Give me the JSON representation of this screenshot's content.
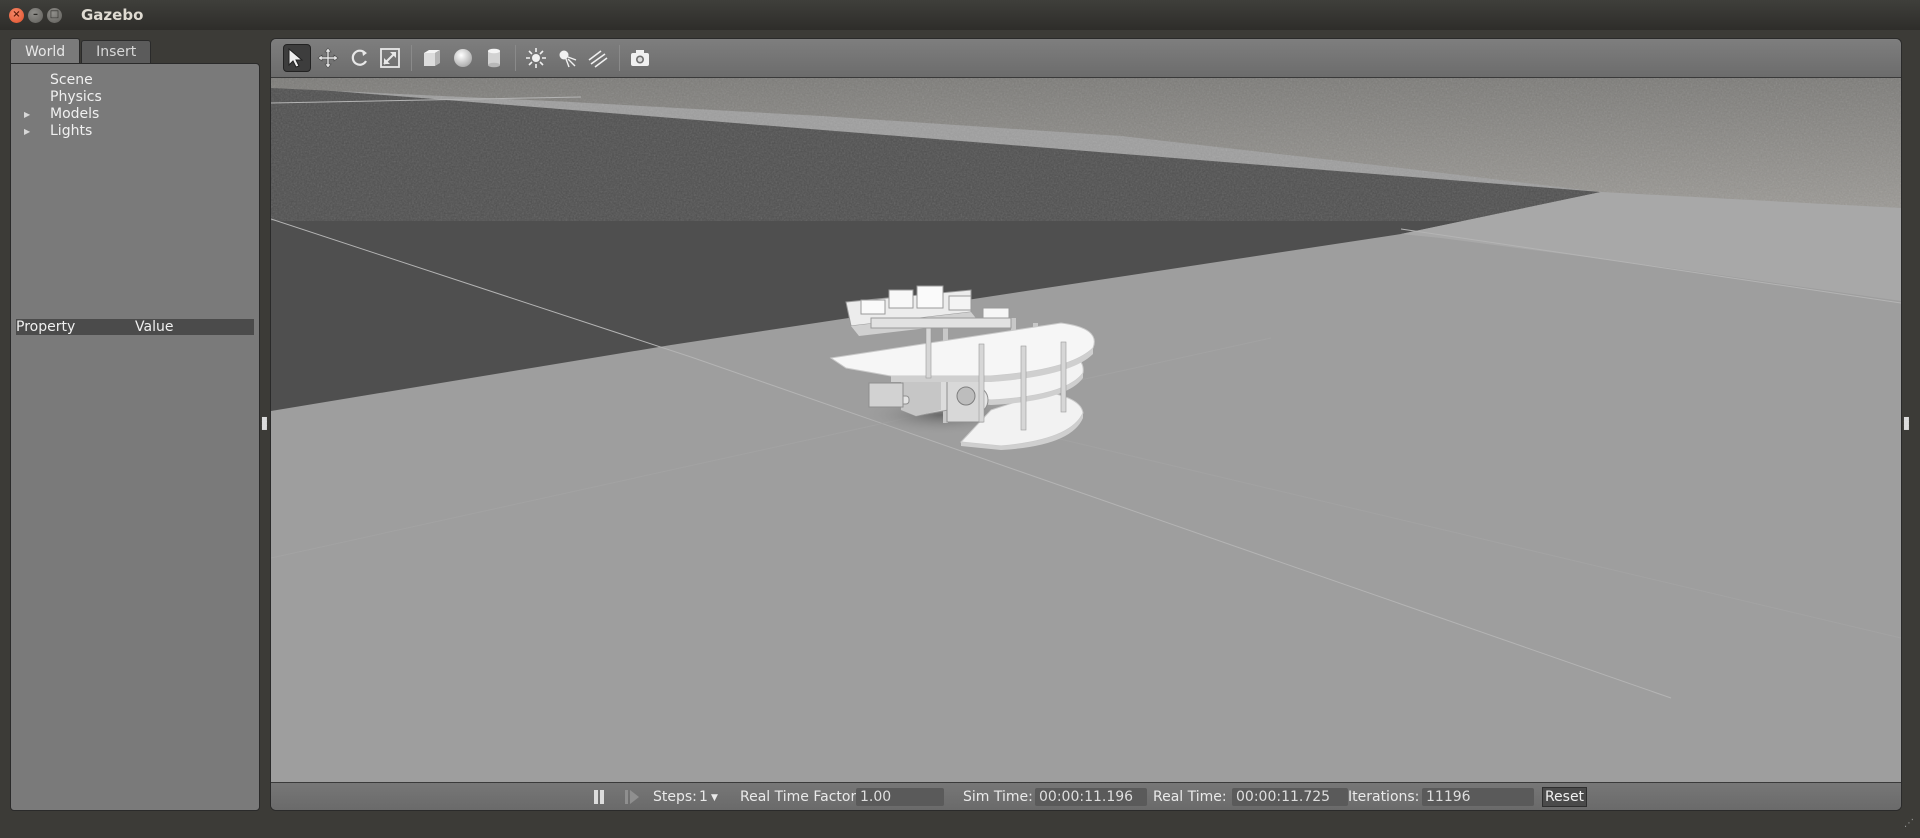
{
  "window": {
    "title": "Gazebo"
  },
  "left_panel": {
    "tabs": [
      {
        "label": "World"
      },
      {
        "label": "Insert"
      }
    ],
    "tree": [
      {
        "label": "Scene",
        "expandable": false
      },
      {
        "label": "Physics",
        "expandable": false
      },
      {
        "label": "Models",
        "expandable": true
      },
      {
        "label": "Lights",
        "expandable": true
      }
    ],
    "properties": {
      "col_property": "Property",
      "col_value": "Value"
    }
  },
  "toolbar": {
    "buttons": [
      {
        "name": "select-mode",
        "icon": "arrow-cursor-icon",
        "active": true
      },
      {
        "name": "translate-mode",
        "icon": "move-arrows-icon"
      },
      {
        "name": "rotate-mode",
        "icon": "rotate-icon"
      },
      {
        "name": "scale-mode",
        "icon": "scale-icon"
      },
      {
        "name": "box-shape",
        "icon": "box-icon"
      },
      {
        "name": "sphere-shape",
        "icon": "sphere-icon"
      },
      {
        "name": "cylinder-shape",
        "icon": "cylinder-icon"
      },
      {
        "name": "point-light",
        "icon": "point-light-icon"
      },
      {
        "name": "spot-light",
        "icon": "spot-light-icon"
      },
      {
        "name": "directional-light",
        "icon": "directional-light-icon"
      },
      {
        "name": "screenshot",
        "icon": "camera-icon"
      }
    ]
  },
  "bottom_bar": {
    "steps_label": "Steps:",
    "steps_value": "1",
    "rtf_label": "Real Time Factor:",
    "rtf_value": "1.00",
    "sim_time_label": "Sim Time:",
    "sim_time_value": "00:00:11.196",
    "real_time_label": "Real Time:",
    "real_time_value": "00:00:11.725",
    "iterations_label": "Iterations:",
    "iterations_value": "11196",
    "reset_label": "Reset"
  },
  "colors": {
    "panel_bg": "#7a7a7a",
    "ground": "#9d9d9d",
    "dark_region": "#4e4e4e"
  }
}
